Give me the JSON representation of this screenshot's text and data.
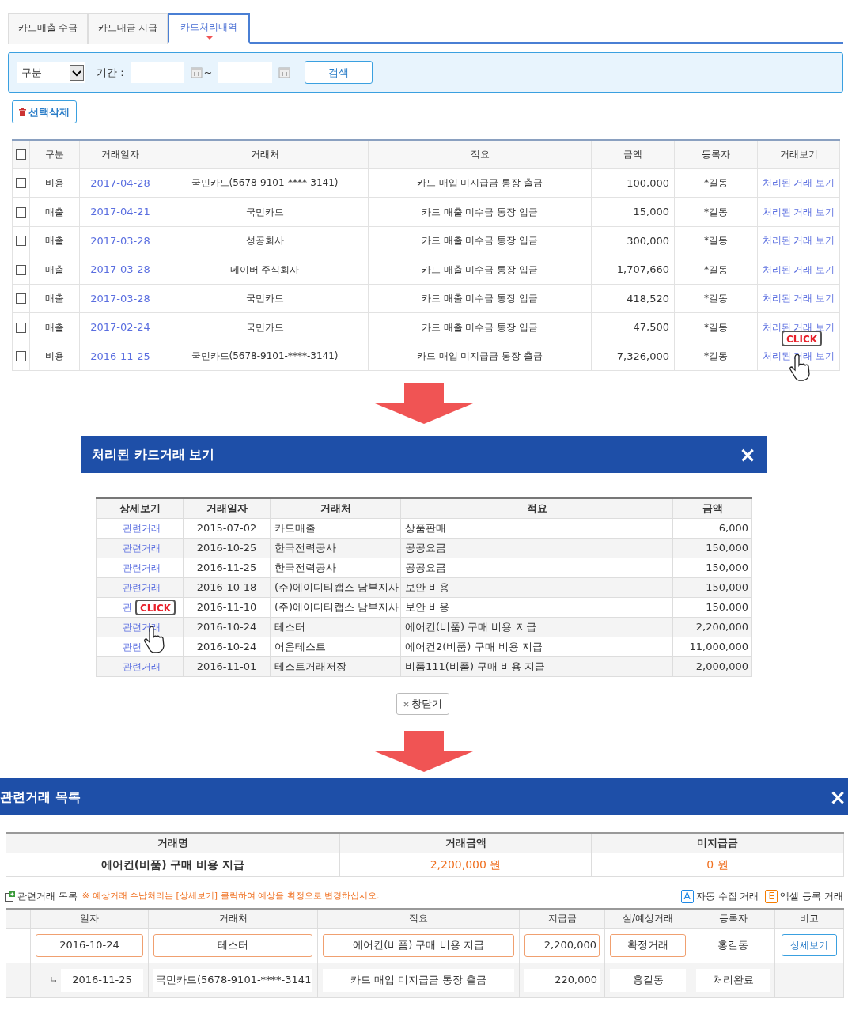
{
  "tabs": [
    {
      "label": "카드매출 수금",
      "selected": false
    },
    {
      "label": "카드대금 지급",
      "selected": false
    },
    {
      "label": "카드처리내역",
      "selected": true
    }
  ],
  "filter": {
    "select": "구분",
    "period_label": "기간 :",
    "range_sep": "~",
    "search_button": "검색"
  },
  "delete_button": "선택삭제",
  "list": {
    "all_checked": false,
    "columns": [
      "구분",
      "거래일자",
      "거래처",
      "적요",
      "금액",
      "등록자",
      "거래보기"
    ],
    "rows": [
      {
        "checked": false,
        "type": "비용",
        "date": "2017-04-28",
        "vendor": "국민카드(5678-9101-****-3141)",
        "memo": "카드 매입 미지급금 통장 출금",
        "amount": "100,000",
        "user": "*길동",
        "link": "처리된 거래 보기"
      },
      {
        "checked": false,
        "type": "매출",
        "date": "2017-04-21",
        "vendor": "국민카드",
        "memo": "카드 매출 미수금 통장 입금",
        "amount": "15,000",
        "user": "*길동",
        "link": "처리된 거래 보기"
      },
      {
        "checked": false,
        "type": "매출",
        "date": "2017-03-28",
        "vendor": "성공회사",
        "memo": "카드 매출 미수금 통장 입금",
        "amount": "300,000",
        "user": "*길동",
        "link": "처리된 거래 보기"
      },
      {
        "checked": false,
        "type": "매출",
        "date": "2017-03-28",
        "vendor": "네이버 주식회사",
        "memo": "카드 매출 미수금 통장 입금",
        "amount": "1,707,660",
        "user": "*길동",
        "link": "처리된 거래 보기"
      },
      {
        "checked": false,
        "type": "매출",
        "date": "2017-03-28",
        "vendor": "국민카드",
        "memo": "카드 매출 미수금 통장 입금",
        "amount": "418,520",
        "user": "*길동",
        "link": "처리된 거래 보기"
      },
      {
        "checked": false,
        "type": "매출",
        "date": "2017-02-24",
        "vendor": "국민카드",
        "memo": "카드 매출 미수금 통장 입금",
        "amount": "47,500",
        "user": "*길동",
        "link": "처리된 거래 보기"
      },
      {
        "checked": false,
        "type": "비용",
        "date": "2016-11-25",
        "vendor": "국민카드(5678-9101-****-3141)",
        "memo": "카드 매입 미지급금 통장 출금",
        "amount": "7,326,000",
        "user": "*길동",
        "link": "처리된 거래 보기"
      }
    ],
    "click_label": "CLICK"
  },
  "popup": {
    "title": "처리된 카드거래 보기",
    "close": "×",
    "columns": [
      "상세보기",
      "거래일자",
      "거래처",
      "적요",
      "금액"
    ],
    "rows": [
      {
        "link": "관련거래",
        "date": "2015-07-02",
        "vendor": "카드매출",
        "memo": "상품판매",
        "amount": "6,000"
      },
      {
        "link": "관련거래",
        "date": "2016-10-25",
        "vendor": "한국전력공사",
        "memo": "공공요금",
        "amount": "150,000"
      },
      {
        "link": "관련거래",
        "date": "2016-11-25",
        "vendor": "한국전력공사",
        "memo": "공공요금",
        "amount": "150,000"
      },
      {
        "link": "관련거래",
        "date": "2016-10-18",
        "vendor": "(주)에이디티캡스 남부지사",
        "memo": "보안 비용",
        "amount": "150,000"
      },
      {
        "link": "관",
        "date": "2016-11-10",
        "vendor": "(주)에이디티캡스 남부지사",
        "memo": "보안 비용",
        "amount": "150,000"
      },
      {
        "link": "관련거래",
        "date": "2016-10-24",
        "vendor": "테스터",
        "memo": "에어컨(비품) 구매 비용 지급",
        "amount": "2,200,000"
      },
      {
        "link": "관련",
        "date": "2016-10-24",
        "vendor": "어음테스트",
        "memo": "에어컨2(비품) 구매 비용 지급",
        "amount": "11,000,000"
      },
      {
        "link": "관련거래",
        "date": "2016-11-01",
        "vendor": "테스트거래저장",
        "memo": "비품111(비품) 구매 비용 지급",
        "amount": "2,000,000"
      }
    ],
    "click_label": "CLICK",
    "close_button": "창닫기"
  },
  "related": {
    "title": "관련거래 목록",
    "close": "×",
    "summary": {
      "columns": [
        "거래명",
        "거래금액",
        "미지급금"
      ],
      "values": [
        "에어컨(비품) 구매 비용 지급",
        "2,200,000 원",
        "0 원"
      ]
    },
    "list_title": "관련거래 목록",
    "notice": "※ 예상거래 수납처리는 [상세보기] 클릭하여 예상을 확정으로 변경하십시오.",
    "legend": [
      {
        "letter": "A",
        "label": "자동 수집 거래",
        "color": "#1e88e5"
      },
      {
        "letter": "E",
        "label": "엑셀 등록 거래",
        "color": "#f57c00"
      }
    ],
    "columns": [
      "일자",
      "거래처",
      "적요",
      "지급금",
      "실/예상거래",
      "등록자",
      "비고"
    ],
    "rows": [
      {
        "kind": "main",
        "date": "2016-10-24",
        "vendor": "테스터",
        "memo": "에어컨(비품) 구매 비용 지급",
        "amount": "2,200,000",
        "status": "확정거래",
        "user": "홍길동",
        "action": "상세보기"
      },
      {
        "kind": "sub",
        "date": "2016-11-25",
        "vendor": "국민카드(5678-9101-****-3141",
        "memo": "카드 매입 미지급금 통장 출금",
        "amount": "220,000",
        "status": "홍길동",
        "user": "처리완료"
      }
    ]
  }
}
